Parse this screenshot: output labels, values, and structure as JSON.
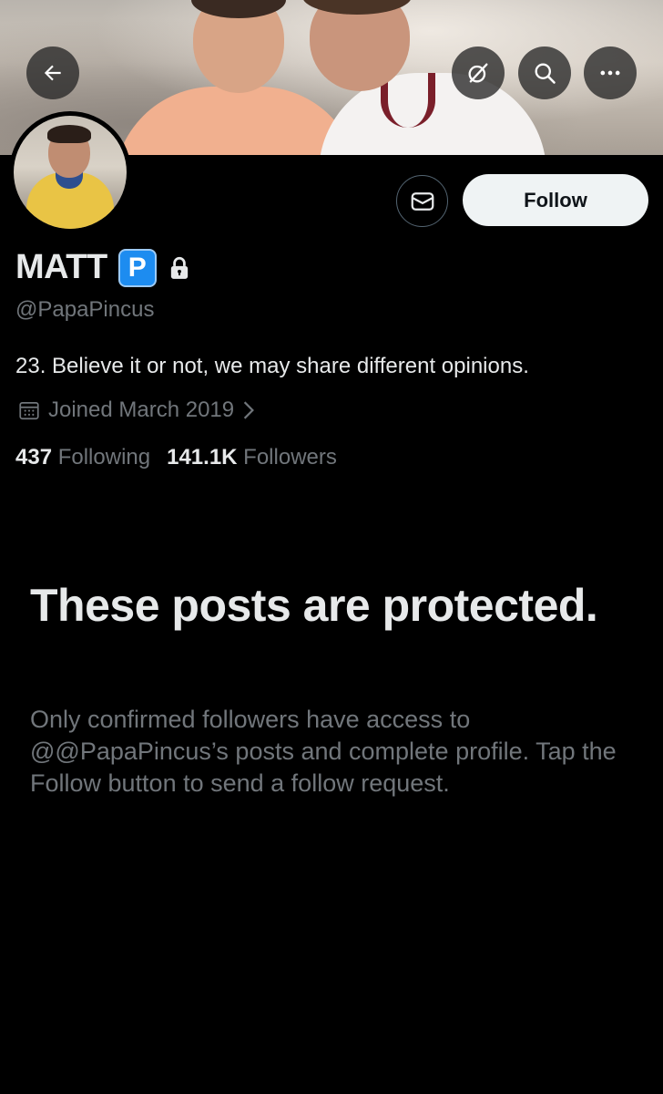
{
  "header": {
    "back_icon": "arrow-left-icon",
    "grok_icon": "grok-icon",
    "search_icon": "search-icon",
    "more_icon": "more-horizontal-icon"
  },
  "profile": {
    "display_name": "MATT",
    "badge_letter": "P",
    "handle": "@PapaPincus",
    "bio": "23. Believe it or not, we may share different opinions.",
    "joined": "Joined March 2019",
    "following_count": "437",
    "following_label": "Following",
    "followers_count": "141.1K",
    "followers_label": "Followers"
  },
  "actions": {
    "message_icon": "mail-icon",
    "follow_label": "Follow"
  },
  "protected": {
    "title": "These posts are protected.",
    "body": "Only confirmed followers have access to @@PapaPincus’s posts and complete profile. Tap the Follow button to send a follow request."
  },
  "colors": {
    "background": "#000000",
    "primary_text": "#e7e9ea",
    "secondary_text": "#71767b",
    "follow_button_bg": "#eff3f4",
    "badge_blue": "#1d8cf0"
  }
}
